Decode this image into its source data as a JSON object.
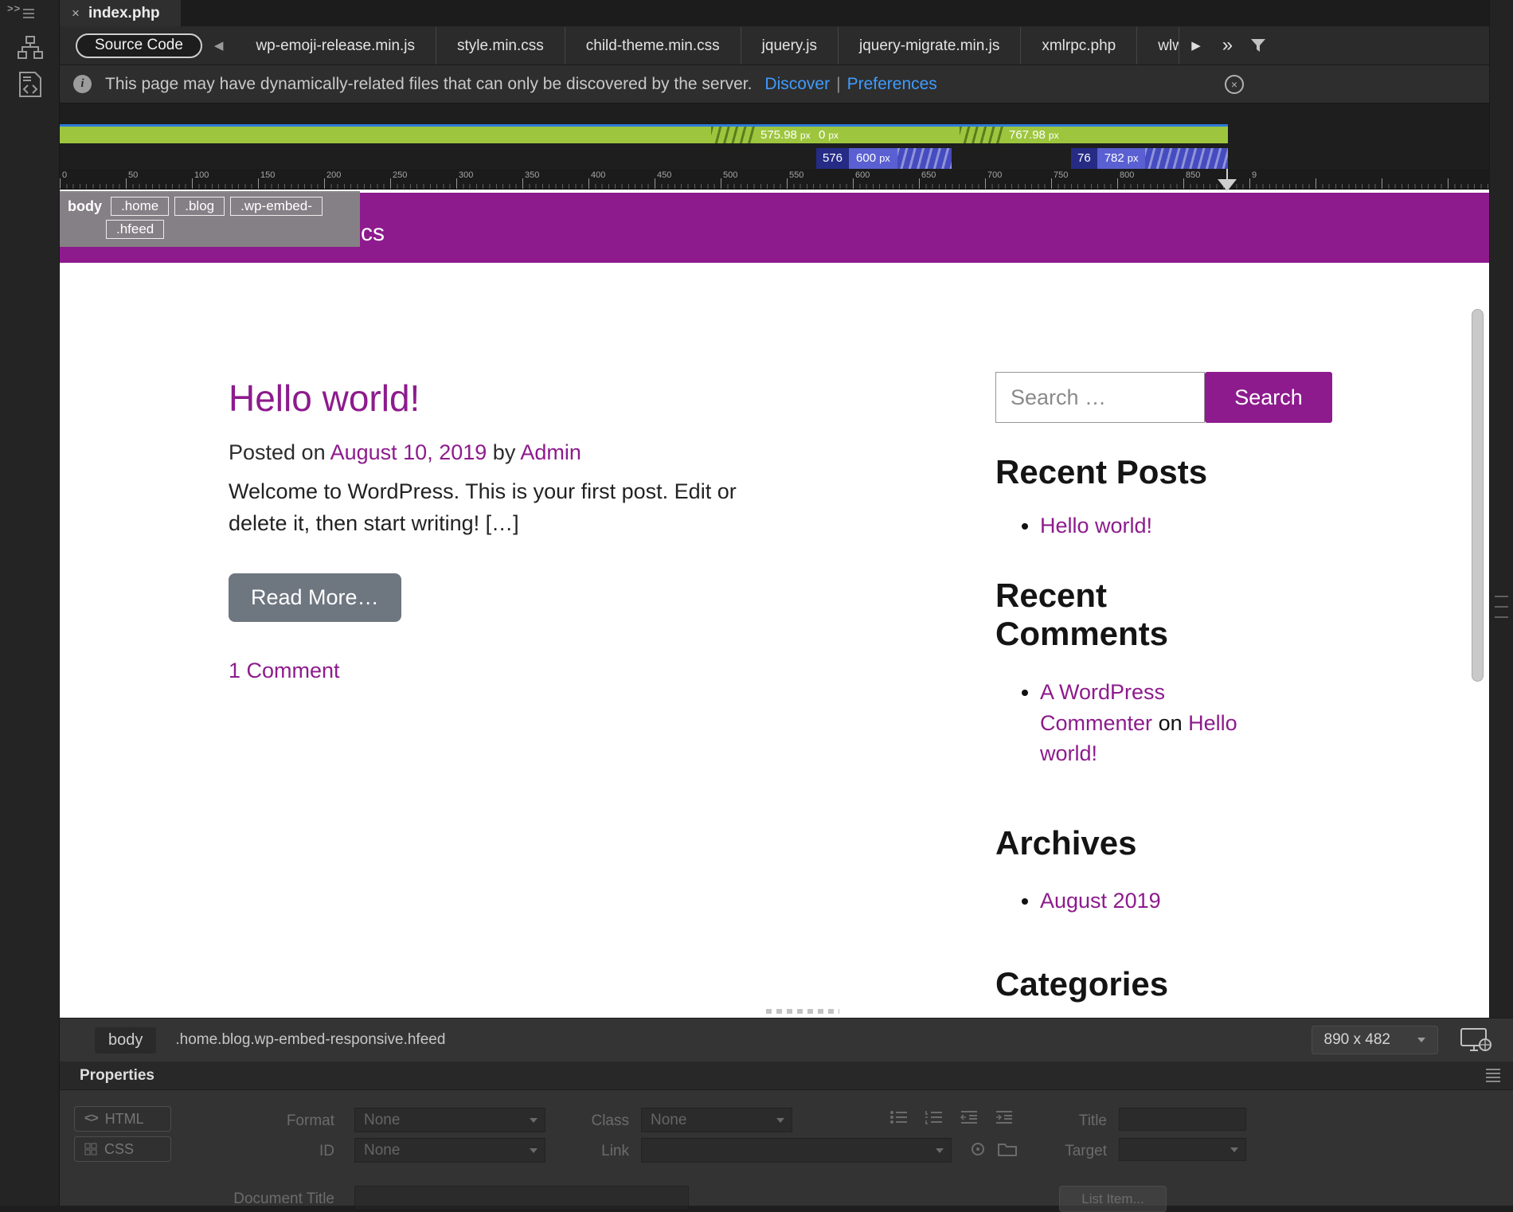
{
  "left_rail": {
    "expander": ">>"
  },
  "document_tab": {
    "close_icon": "×",
    "title": "index.php"
  },
  "related_files_bar": {
    "source_code_label": "Source Code",
    "back_icon": "◀",
    "forward_icon": "▶",
    "overflow_icon": "»",
    "files": [
      "wp-emoji-release.min.js",
      "style.min.css",
      "child-theme.min.css",
      "jquery.js",
      "jquery-migrate.min.js",
      "xmlrpc.php",
      "wlw"
    ]
  },
  "info_bar": {
    "info_icon": "i",
    "message": "This page may have dynamically-related files that can only be discovered by the server.",
    "discover_link": "Discover",
    "separator": "|",
    "preferences_link": "Preferences",
    "close_icon": "×"
  },
  "media_query_bar": {
    "green_labels": [
      {
        "value": "575.98",
        "unit": "px"
      },
      {
        "value": "0",
        "unit": "px"
      },
      {
        "value": "767.98",
        "unit": "px"
      }
    ],
    "ranges": [
      {
        "min": "576",
        "max": "600",
        "unit": "px"
      },
      {
        "min": "76",
        "max": "782",
        "unit": "px"
      }
    ]
  },
  "ruler": {
    "labels": [
      "0",
      "50",
      "100",
      "150",
      "200",
      "250",
      "300",
      "350",
      "400",
      "450",
      "500",
      "550",
      "600",
      "650",
      "700",
      "750",
      "800",
      "850",
      "9"
    ]
  },
  "tag_selector_overlay": {
    "root": "body",
    "row1": [
      ".home",
      ".blog",
      ".wp-embed-"
    ],
    "row2": [
      ".hfeed"
    ]
  },
  "live_view": {
    "header_title_visible": "cs",
    "post": {
      "title": "Hello world!",
      "posted_on": "Posted on",
      "date": "August 10, 2019",
      "by": "by",
      "author": "Admin",
      "excerpt": "Welcome to WordPress. This is your first post. Edit or delete it, then start writing! […]",
      "read_more": "Read More…",
      "comments": "1 Comment"
    },
    "sidebar": {
      "search_placeholder": "Search …",
      "search_button": "Search",
      "recent_posts_title": "Recent Posts",
      "recent_posts_item": "Hello world!",
      "recent_comments_title": "Recent Comments",
      "recent_comment_author": "A WordPress Commenter",
      "recent_comment_on": "on",
      "recent_comment_post": "Hello world!",
      "archives_title": "Archives",
      "archives_item": "August 2019",
      "categories_title": "Categories"
    }
  },
  "status_bar": {
    "tag": "body",
    "selector_path": ".home.blog.wp-embed-responsive.hfeed",
    "viewport_size": "890 x 482"
  },
  "properties_panel": {
    "title": "Properties",
    "html_icon": "<>",
    "html_button": "HTML",
    "css_button": "CSS",
    "format_label": "Format",
    "format_value": "None",
    "id_label": "ID",
    "id_value": "None",
    "class_label": "Class",
    "class_value": "None",
    "link_label": "Link",
    "title_label": "Title",
    "target_label": "Target",
    "document_title_label": "Document Title",
    "list_item_button": "List Item..."
  }
}
